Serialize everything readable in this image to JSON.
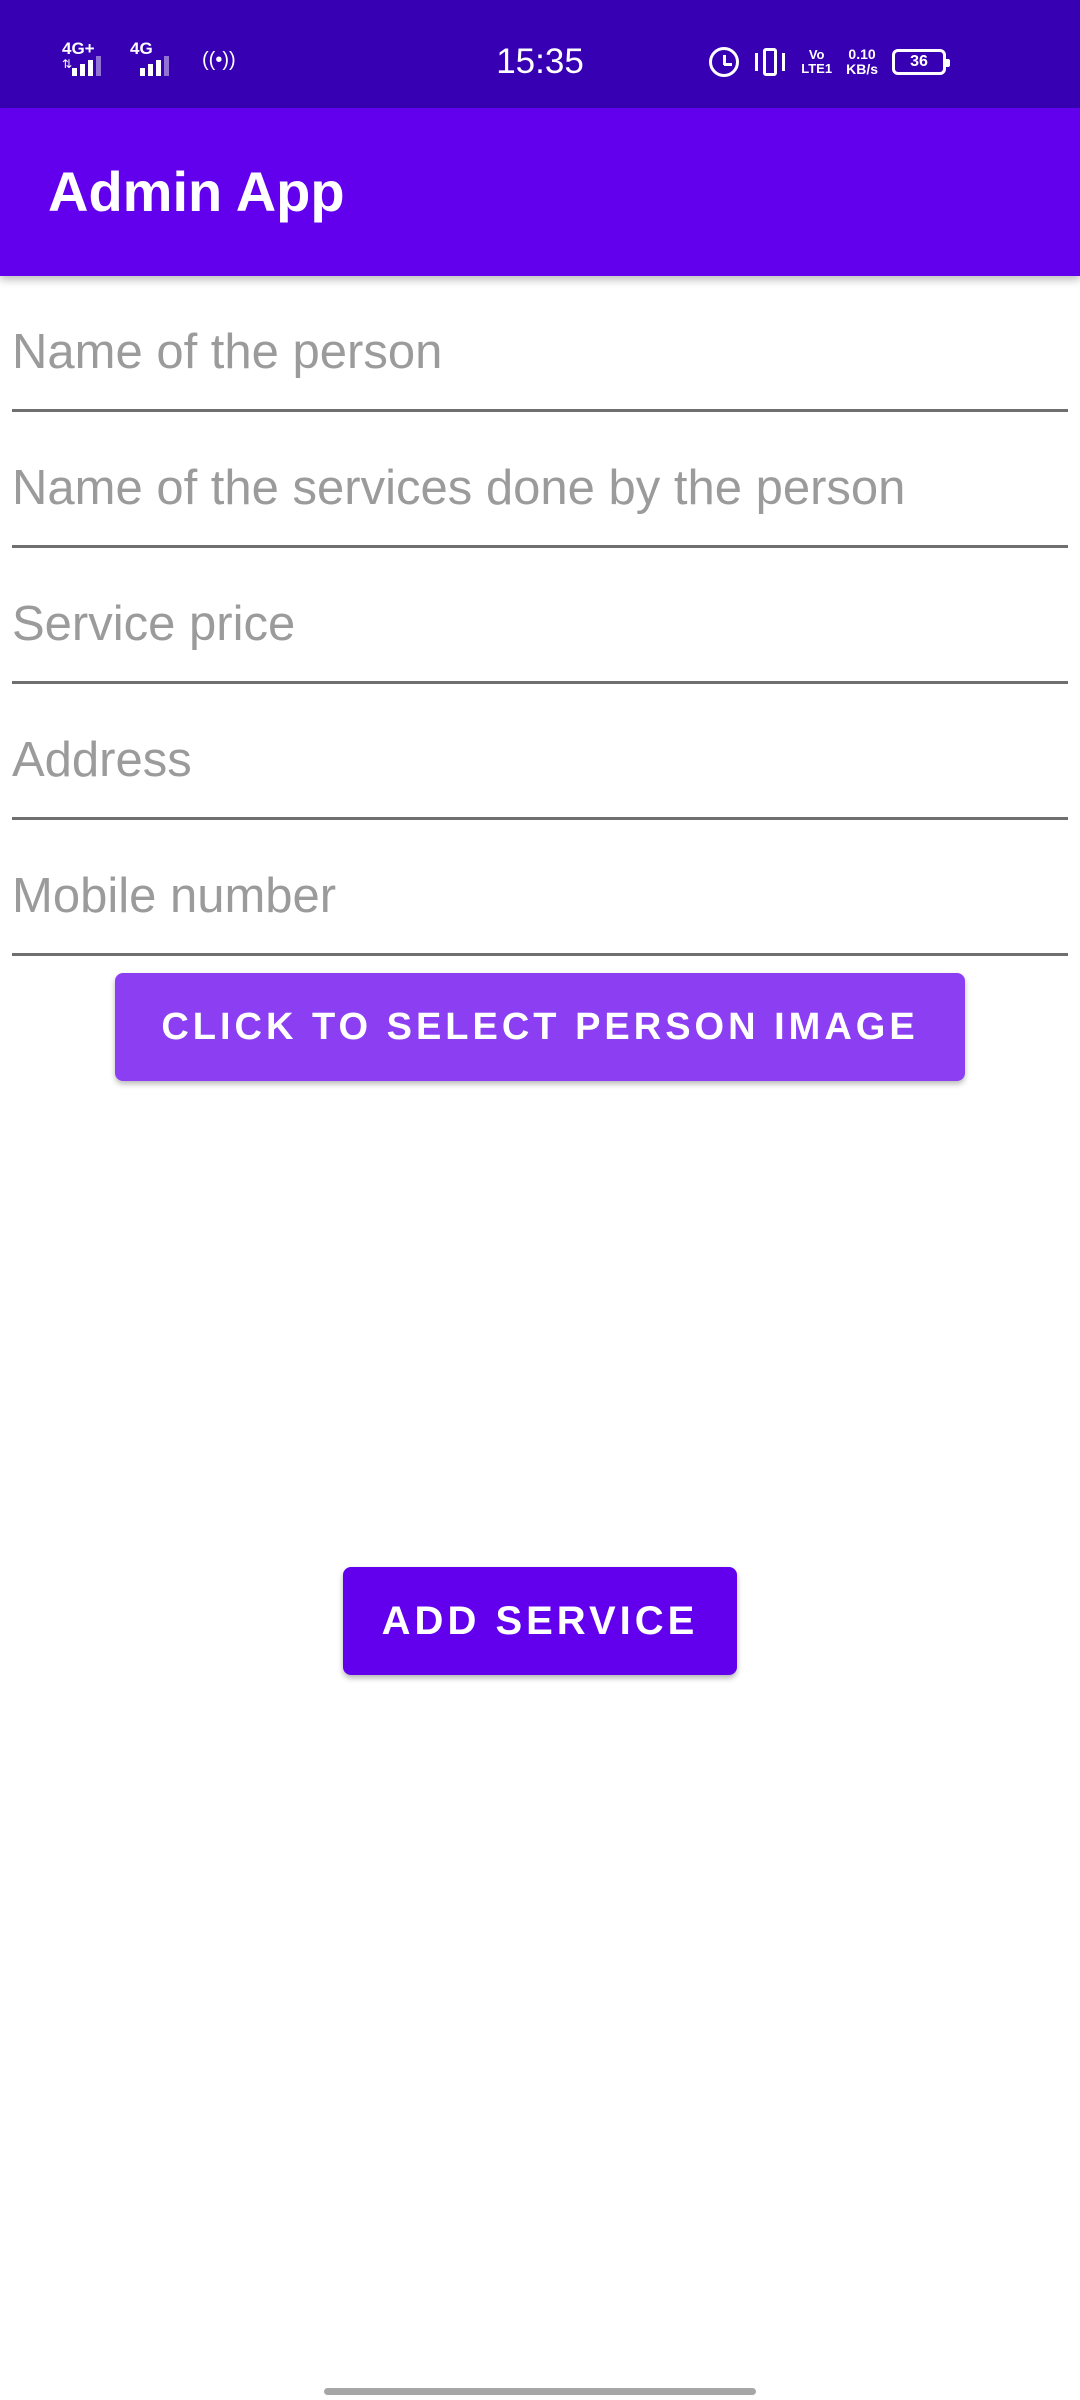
{
  "status_bar": {
    "network1": "4G+",
    "network2": "4G",
    "time": "15:35",
    "volte_top": "Vo",
    "volte_bottom": "LTE1",
    "speed_value": "0.10",
    "speed_unit": "KB/s",
    "battery": "36",
    "icons": [
      "signal-icon",
      "hotspot-icon",
      "alarm-icon",
      "vibrate-icon",
      "battery-icon"
    ]
  },
  "app_bar": {
    "title": "Admin App",
    "color": "#6200ee"
  },
  "form": {
    "person_name": {
      "placeholder": "Name of the person",
      "value": ""
    },
    "services": {
      "placeholder": "Name of the services done by the person",
      "value": ""
    },
    "price": {
      "placeholder": "Service price",
      "value": ""
    },
    "address": {
      "placeholder": "Address",
      "value": ""
    },
    "mobile": {
      "placeholder": "Mobile number",
      "value": ""
    }
  },
  "buttons": {
    "select_image": "CLICK TO SELECT PERSON IMAGE",
    "add_service": "ADD SERVICE"
  },
  "colors": {
    "status_bar": "#3700b3",
    "primary": "#6200ee",
    "secondary_button": "#8c3ff2"
  }
}
